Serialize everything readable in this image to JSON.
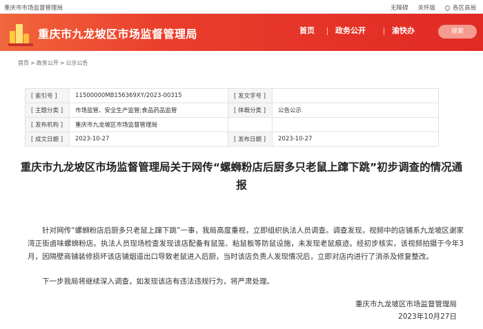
{
  "topbar": {
    "site_name": "重庆市市场监督管理局",
    "links": [
      "无障碍",
      "关怀版",
      "各区县局"
    ]
  },
  "header": {
    "org_title": "重庆市九龙坡区市场监督管理局",
    "nav": [
      "首页",
      "政务公开",
      "渝快办"
    ],
    "search_label": "搜索",
    "colors": {
      "start": "#f1663c",
      "end": "#e02a24"
    }
  },
  "breadcrumb": [
    "首页",
    "政务公开",
    "公示公告"
  ],
  "meta": {
    "rows": [
      {
        "label": "索引号",
        "value": "11500000MB156369XY/2023-00315",
        "label2": "发文字号",
        "value2": ""
      },
      {
        "label": "主题分类",
        "value": "市场监管、安全生产监管;食品药品监管",
        "label2": "体裁分类",
        "value2": "公告公示"
      },
      {
        "label": "发布机构",
        "value": "重庆市九龙坡区市场监督管理局",
        "label2": "",
        "value2": ""
      },
      {
        "label": "成文日期",
        "value": "2023-10-27",
        "label2": "发布日期",
        "value2": "2023-10-27"
      }
    ]
  },
  "article": {
    "title": "重庆市九龙坡区市场监督管理局关于网传“螺蛳粉店后厨多只老鼠上蹿下跳”初步调查的情况通报",
    "paragraphs": [
      "针对网传“螺蛳粉店后厨多只老鼠上蹿下跳”一事，我局高度重视，立即组织执法人员调查。调查发现，视频中的店铺系九龙坡区谢家湾正街卤味螺蛳粉店。执法人员现场检查发现该店配备有鼠笼、粘鼠板等防鼠设施，未发现老鼠痕迹。经初步核实，该视频拍摄于今年3月，因隔壁商铺装修损坏该店铺烟道出口导致老鼠进入后厨，当时该店负责人发现情况后，立即对店内进行了消杀及修复整改。",
      "下一步我局将继续深入调查，如发现该店有违法违规行为，将严肃处理。"
    ],
    "signature": "重庆市九龙坡区市场监督管理局",
    "date": "2023年10月27日"
  }
}
